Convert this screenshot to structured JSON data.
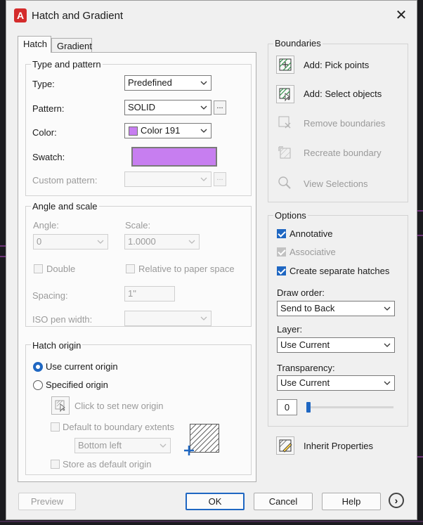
{
  "window": {
    "title": "Hatch and Gradient",
    "app_icon": "A",
    "close_glyph": "✕"
  },
  "tabs": [
    {
      "label": "Hatch",
      "active": true
    },
    {
      "label": "Gradient",
      "active": false
    }
  ],
  "type_pattern": {
    "title": "Type and pattern",
    "type_label": "Type:",
    "type_value": "Predefined",
    "pattern_label": "Pattern:",
    "pattern_value": "SOLID",
    "pattern_more": "...",
    "color_label": "Color:",
    "color_value": "Color 191",
    "color_hex": "#c77ef0",
    "swatch_label": "Swatch:",
    "custom_label": "Custom pattern:",
    "custom_more": "..."
  },
  "angle_scale": {
    "title": "Angle and scale",
    "angle_label": "Angle:",
    "angle_value": "0",
    "scale_label": "Scale:",
    "scale_value": "1.0000",
    "double_label": "Double",
    "relative_label": "Relative to paper space",
    "spacing_label": "Spacing:",
    "spacing_value": "1\"",
    "iso_label": "ISO pen width:"
  },
  "hatch_origin": {
    "title": "Hatch origin",
    "use_current": "Use current origin",
    "specified": "Specified origin",
    "click_set": "Click to set new origin",
    "default_boundary": "Default to boundary extents",
    "position_value": "Bottom left",
    "store_default": "Store as default origin"
  },
  "boundaries": {
    "title": "Boundaries",
    "pick_points": "Add: Pick points",
    "select_objects": "Add: Select objects",
    "remove": "Remove boundaries",
    "recreate": "Recreate boundary",
    "view": "View Selections"
  },
  "options": {
    "title": "Options",
    "annotative": "Annotative",
    "associative": "Associative",
    "separate": "Create separate hatches",
    "draw_order_label": "Draw order:",
    "draw_order_value": "Send to Back",
    "layer_label": "Layer:",
    "layer_value": "Use Current",
    "transparency_label": "Transparency:",
    "transparency_value": "Use Current",
    "transparency_number": "0"
  },
  "inherit": "Inherit Properties",
  "footer": {
    "preview": "Preview",
    "ok": "OK",
    "cancel": "Cancel",
    "help": "Help",
    "more_glyph": "›"
  },
  "colors": {
    "accent": "#1f67c2",
    "hatch_color": "#c77ef0",
    "brand_red": "#d42b2b"
  }
}
